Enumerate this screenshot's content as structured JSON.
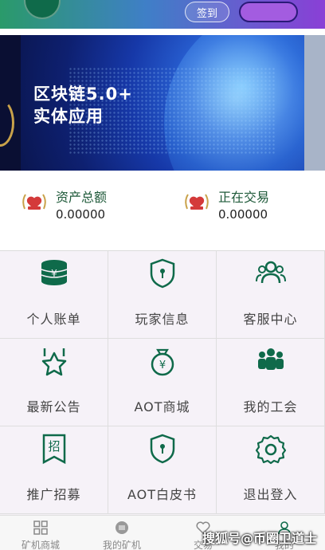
{
  "header": {
    "title": "",
    "sign_in_label": "签到",
    "other_button_label": ""
  },
  "banner": {
    "headline_line1": "区块链5.0+",
    "headline_line2": "实体应用"
  },
  "stats": [
    {
      "label": "资产总额",
      "value": "0.00000"
    },
    {
      "label": "正在交易",
      "value": "0.00000"
    }
  ],
  "menu": [
    {
      "label": "个人账单",
      "icon": "coins-stack-icon"
    },
    {
      "label": "玩家信息",
      "icon": "shield-lock-icon"
    },
    {
      "label": "客服中心",
      "icon": "users-icon"
    },
    {
      "label": "最新公告",
      "icon": "star-ribbon-icon"
    },
    {
      "label": "AOT商城",
      "icon": "money-bag-icon"
    },
    {
      "label": "我的工会",
      "icon": "group-icon"
    },
    {
      "label": "推广招募",
      "icon": "recruit-banner-icon"
    },
    {
      "label": "AOT白皮书",
      "icon": "shield-lock-icon"
    },
    {
      "label": "退出登入",
      "icon": "gear-icon"
    }
  ],
  "tabs": [
    {
      "label": "矿机商城",
      "icon": "grid-icon"
    },
    {
      "label": "我的矿机",
      "icon": "machine-icon"
    },
    {
      "label": "交易",
      "icon": "heart-trade-icon"
    },
    {
      "label": "我的",
      "icon": "person-icon"
    }
  ],
  "watermark": "搜狐号@币圈卫道士",
  "colors": {
    "accent_green": "#0f6a4a",
    "grid_background": "#f6f2f8",
    "banner_blue": "#1638a8"
  }
}
